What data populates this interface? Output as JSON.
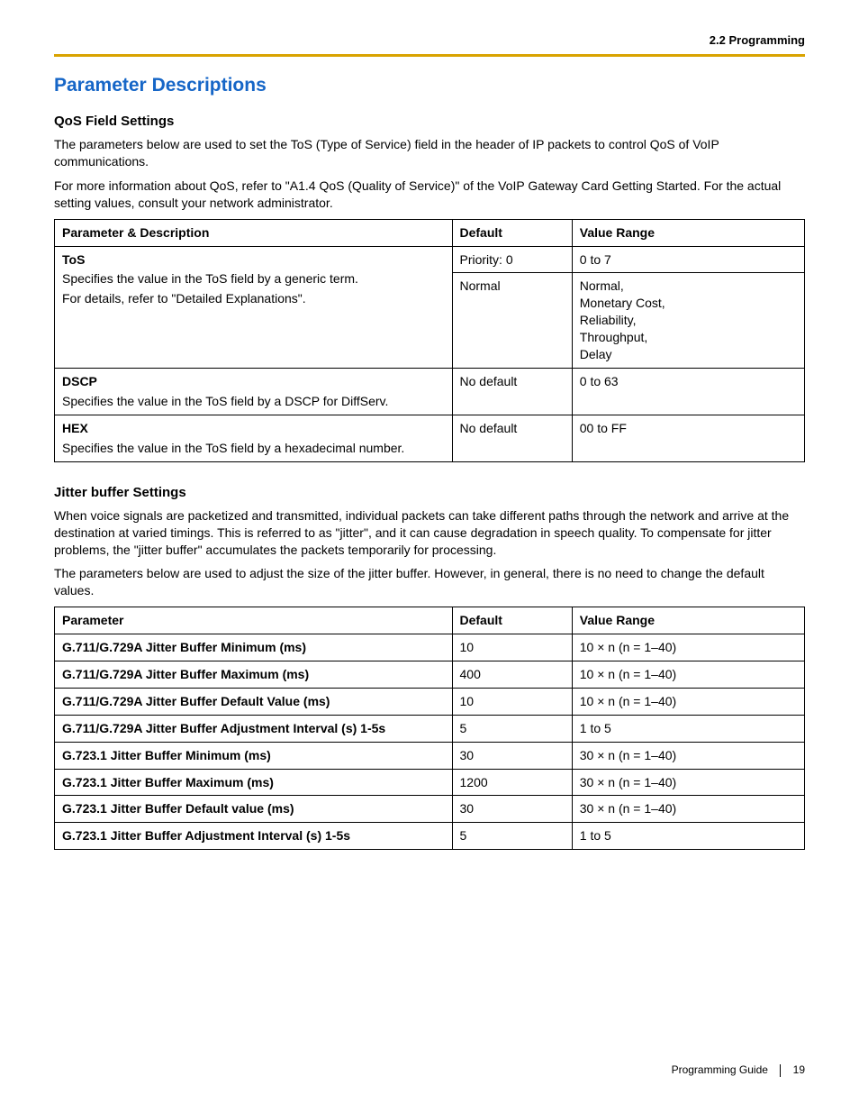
{
  "header": {
    "section": "2.2 Programming"
  },
  "title": "Parameter Descriptions",
  "qos": {
    "heading": "QoS Field Settings",
    "p1": "The parameters below are used to set the ToS (Type of Service) field in the header of IP packets to control QoS of VoIP communications.",
    "p2": "For more information about QoS, refer to \"A1.4 QoS (Quality of Service)\" of the VoIP Gateway Card Getting Started. For the actual setting values, consult your network administrator.",
    "cols": {
      "c1": "Parameter & Description",
      "c2": "Default",
      "c3": "Value Range"
    },
    "tos": {
      "name": "ToS",
      "desc1": "Specifies the value in the ToS field by a generic term.",
      "desc2": "For details, refer to \"Detailed Explanations\".",
      "def1": "Priority: 0",
      "range1": "0 to 7",
      "def2": "Normal",
      "range2": "Normal,\nMonetary Cost,\nReliability,\nThroughput,\nDelay"
    },
    "dscp": {
      "name": "DSCP",
      "desc": "Specifies the value in the ToS field by a DSCP for DiffServ.",
      "def": "No default",
      "range": "0 to 63"
    },
    "hex": {
      "name": "HEX",
      "desc": "Specifies the value in the ToS field by a hexadecimal number.",
      "def": "No default",
      "range": "00 to FF"
    }
  },
  "jitter": {
    "heading": "Jitter buffer Settings",
    "p1": "When voice signals are packetized and transmitted, individual packets can take different paths through the network and arrive at the destination at varied timings. This is referred to as \"jitter\", and it can cause degradation in speech quality. To compensate for jitter problems, the \"jitter buffer\" accumulates the packets temporarily for processing.",
    "p2": "The parameters below are used to adjust the size of the jitter buffer. However, in general, there is no need to change the default values.",
    "cols": {
      "c1": "Parameter",
      "c2": "Default",
      "c3": "Value Range"
    },
    "rows": [
      {
        "p": "G.711/G.729A Jitter Buffer Minimum (ms)",
        "d": "10",
        "r": "10 × n (n = 1–40)"
      },
      {
        "p": "G.711/G.729A Jitter Buffer Maximum (ms)",
        "d": "400",
        "r": "10 × n (n = 1–40)"
      },
      {
        "p": "G.711/G.729A Jitter Buffer Default Value (ms)",
        "d": "10",
        "r": "10 × n (n = 1–40)"
      },
      {
        "p": "G.711/G.729A Jitter Buffer Adjustment Interval (s) 1-5s",
        "d": "5",
        "r": "1 to 5"
      },
      {
        "p": "G.723.1 Jitter Buffer Minimum (ms)",
        "d": "30",
        "r": "30 × n (n = 1–40)"
      },
      {
        "p": "G.723.1 Jitter Buffer Maximum (ms)",
        "d": "1200",
        "r": "30 × n (n = 1–40)"
      },
      {
        "p": "G.723.1 Jitter Buffer Default value (ms)",
        "d": "30",
        "r": "30 × n (n = 1–40)"
      },
      {
        "p": "G.723.1 Jitter Buffer Adjustment Interval (s) 1-5s",
        "d": "5",
        "r": "1 to 5"
      }
    ]
  },
  "footer": {
    "doc": "Programming Guide",
    "page": "19"
  }
}
